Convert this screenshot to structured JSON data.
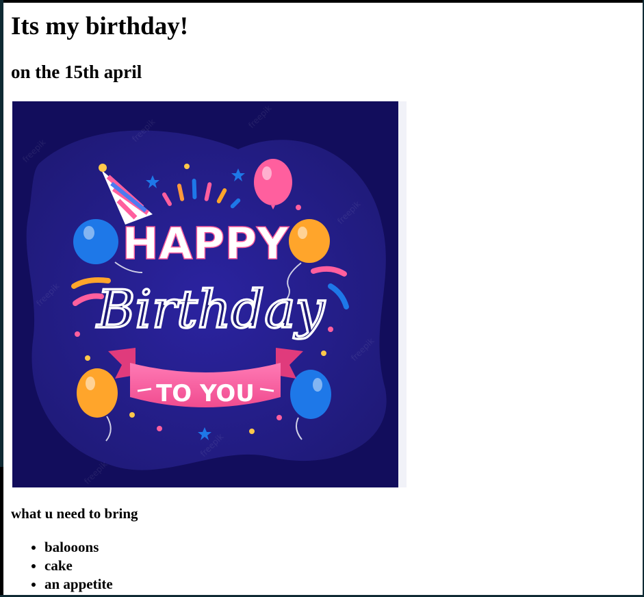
{
  "page": {
    "title": "Its my birthday!",
    "subtitle": "on the 15th april",
    "card": {
      "word_happy": "HAPPY",
      "word_birthday": "Birthday",
      "word_to_you": "TO YOU",
      "watermark": "freepik"
    },
    "bring_heading": "what u need to bring",
    "bring_items": [
      "balooons",
      "cake",
      "an appetite"
    ]
  },
  "colors": {
    "card_background": "#1f1a78",
    "card_background_dark": "#120d5c",
    "ribbon": "#ff5f9e",
    "balloon_blue": "#1e78e8",
    "balloon_orange": "#ffa52b",
    "balloon_pink": "#ff5f9e",
    "lettering": "#ffffff"
  },
  "icons": [
    "party-hat-icon",
    "balloon-icon",
    "star-icon",
    "confetti-icon",
    "ribbon-banner-icon"
  ]
}
